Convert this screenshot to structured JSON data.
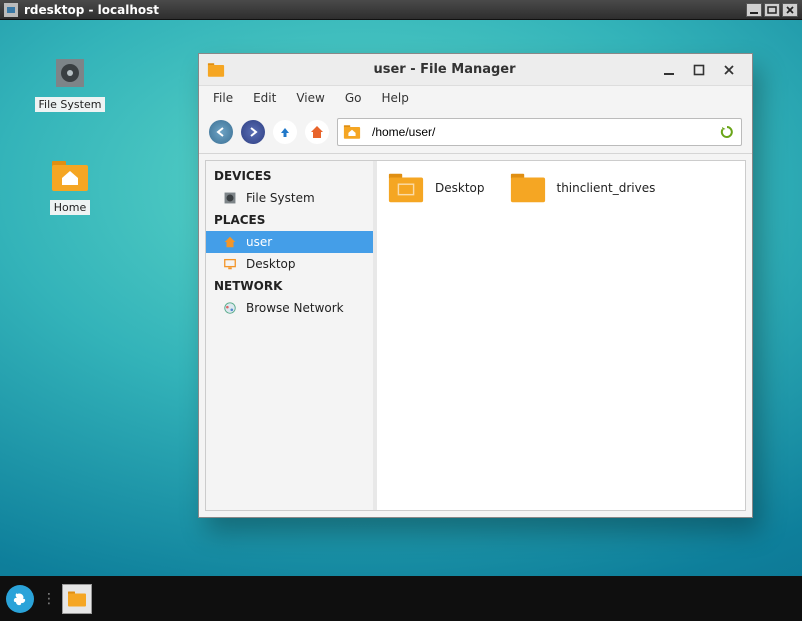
{
  "outer_window": {
    "title": "rdesktop - localhost"
  },
  "desktop": {
    "icons": [
      {
        "name": "file-system",
        "label": "File System"
      },
      {
        "name": "home",
        "label": "Home"
      }
    ]
  },
  "fm": {
    "title": "user - File Manager",
    "menu": {
      "file": "File",
      "edit": "Edit",
      "view": "View",
      "go": "Go",
      "help": "Help"
    },
    "location": "/home/user/",
    "sidebar": {
      "devices_head": "DEVICES",
      "devices": [
        {
          "label": "File System"
        }
      ],
      "places_head": "PLACES",
      "places": [
        {
          "label": "user",
          "selected": true
        },
        {
          "label": "Desktop",
          "selected": false
        }
      ],
      "network_head": "NETWORK",
      "network": [
        {
          "label": "Browse Network"
        }
      ]
    },
    "files": [
      {
        "label": "Desktop"
      },
      {
        "label": "thinclient_drives"
      }
    ]
  }
}
